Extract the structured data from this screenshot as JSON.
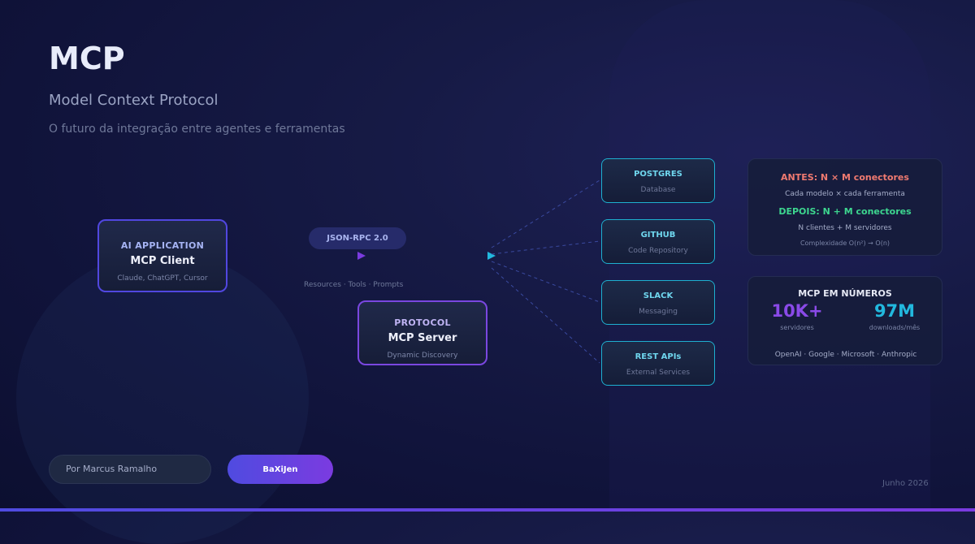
{
  "header": {
    "title": "MCP",
    "subtitle": "Model Context Protocol",
    "tagline": "O futuro da integração entre agentes e ferramentas"
  },
  "diagram": {
    "client": {
      "kicker": "AI APPLICATION",
      "name": "MCP Client",
      "examples": "Claude, ChatGPT, Cursor"
    },
    "transport": {
      "label": "JSON-RPC 2.0",
      "capabilities": "Resources · Tools · Prompts"
    },
    "server": {
      "kicker": "PROTOCOL",
      "name": "MCP Server",
      "feature": "Dynamic Discovery"
    },
    "tools": [
      {
        "name": "POSTGRES",
        "desc": "Database"
      },
      {
        "name": "GITHUB",
        "desc": "Code Repository"
      },
      {
        "name": "SLACK",
        "desc": "Messaging"
      },
      {
        "name": "REST APIs",
        "desc": "External Services"
      }
    ]
  },
  "comparison": {
    "before_title": "ANTES: N × M conectores",
    "before_note": "Cada modelo × cada ferramenta",
    "after_title": "DEPOIS: N + M conectores",
    "after_note": "N clientes + M servidores",
    "complexity": "Complexidade O(n²) → O(n)"
  },
  "stats": {
    "title": "MCP EM NÚMEROS",
    "items": [
      {
        "value": "10K+",
        "label": "servidores"
      },
      {
        "value": "97M",
        "label": "downloads/mês"
      }
    ],
    "partners": "OpenAI · Google · Microsoft · Anthropic"
  },
  "footer": {
    "author": "Por Marcus Ramalho",
    "brand": "BaXiJen",
    "date": "Junho 2026"
  },
  "colors": {
    "accent_indigo": "#4f4be0",
    "accent_violet": "#7b3be0",
    "accent_cyan": "#1eb0d0",
    "before_red": "#f07a70",
    "after_green": "#3dd68f"
  }
}
